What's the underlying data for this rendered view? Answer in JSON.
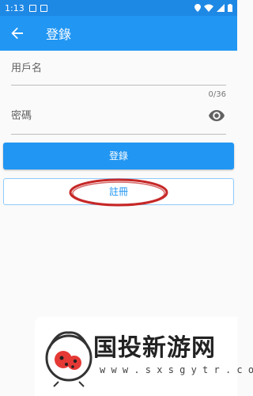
{
  "status_bar": {
    "time": "1:13",
    "left_icons": [
      "image-notification-icon",
      "a-notification-icon"
    ],
    "right_icons": [
      "location-icon",
      "wifi-icon",
      "signal-icon",
      "battery-icon"
    ]
  },
  "app_bar": {
    "title": "登錄",
    "back_icon": "arrow-left-icon"
  },
  "form": {
    "username_placeholder": "用戶名",
    "password_counter": "0/36",
    "password_placeholder": "密碼",
    "visibility_icon": "eye-icon"
  },
  "buttons": {
    "login_label": "登錄",
    "register_label": "註冊"
  },
  "watermark": {
    "name": "国投新游网",
    "url": "w w w . s x s g y t r . c o m"
  },
  "colors": {
    "primary": "#2196f3",
    "status_bar": "#1e88e5",
    "annotation": "#c62828"
  }
}
